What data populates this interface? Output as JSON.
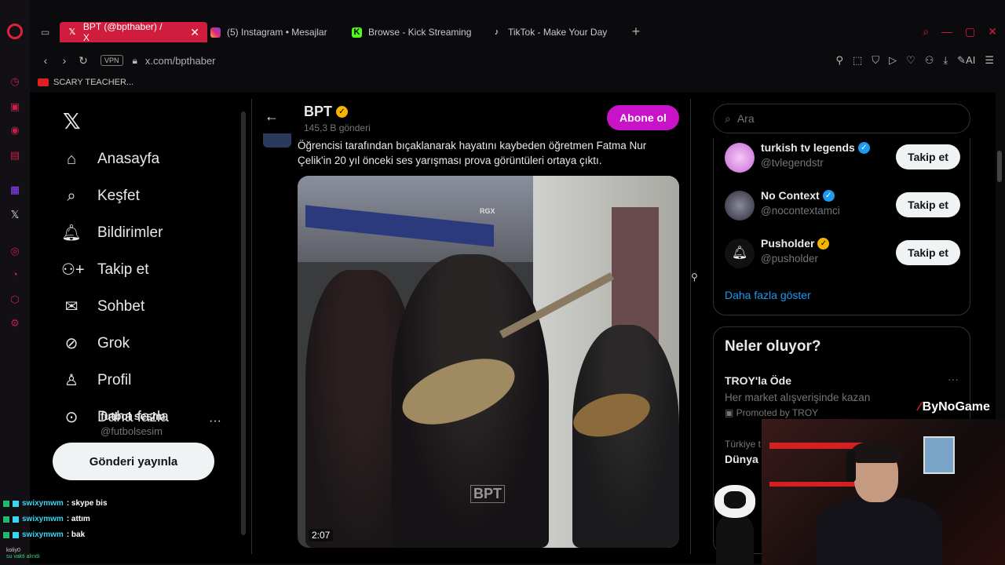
{
  "browser": {
    "tabs": [
      {
        "label": "BPT (@bpthaber) / X",
        "favicon": "X",
        "active": true
      },
      {
        "label": "(5) Instagram • Mesajlar",
        "favicon": "instagram",
        "active": false
      },
      {
        "label": "Browse - Kick Streaming",
        "favicon": "K",
        "active": false
      },
      {
        "label": "TikTok - Make Your Day",
        "favicon": "tiktok",
        "active": false
      }
    ],
    "url": "x.com/bpthaber",
    "vpn_label": "VPN",
    "ai_label": "AI",
    "bookmark": "SCARY TEACHER...",
    "accent_color": "#d11d3d"
  },
  "x_nav": {
    "items": [
      {
        "label": "Anasayfa",
        "icon": "home-icon"
      },
      {
        "label": "Keşfet",
        "icon": "search-icon"
      },
      {
        "label": "Bildirimler",
        "icon": "bell-icon"
      },
      {
        "label": "Takip et",
        "icon": "add-user-icon"
      },
      {
        "label": "Sohbet",
        "icon": "mail-icon"
      },
      {
        "label": "Grok",
        "icon": "grok-icon"
      },
      {
        "label": "Profil",
        "icon": "person-icon"
      },
      {
        "label": "Daha fazla",
        "icon": "more-circle-icon"
      }
    ],
    "post_button": "Gönderi yayınla",
    "account": {
      "name": "futbol sesim",
      "handle": "@futbolsesim"
    }
  },
  "profile": {
    "name": "BPT",
    "post_count": "145,3 B gönderi",
    "subscribe_button": "Abone ol"
  },
  "tweet": {
    "text": "Öğrencisi tarafından bıçaklanarak hayatını kaybeden öğretmen Fatma Nur Çelik'in 20 yıl önceki ses yarışması prova görüntüleri ortaya çıktı.",
    "video_time": "2:07",
    "watermark_top": "RGX",
    "watermark_bottom": "BPT"
  },
  "right": {
    "search_placeholder": "Ara",
    "who_to_follow": [
      {
        "name": "turkish tv legends",
        "handle": "@tvlegendstr",
        "button": "Takip et",
        "avatar_color": "#e8a0e8"
      },
      {
        "name": "No Context",
        "handle": "@nocontextamci",
        "button": "Takip et",
        "avatar_color": "#4a4a5a"
      },
      {
        "name": "Pusholder",
        "handle": "@pusholder",
        "button": "Takip et",
        "avatar_color": "#111111"
      }
    ],
    "show_more": "Daha fazla göster",
    "trends_title": "Neler oluyor?",
    "trend_promo": {
      "name": "TROY'la Öde",
      "desc": "Her market alışverişinde kazan",
      "promoted": "Promoted by TROY"
    },
    "trend_2": {
      "category": "Türkiye t",
      "name": "Dünya"
    }
  },
  "stream": {
    "brand": "ByNoGame",
    "chat": [
      {
        "user": "swixymwm",
        "msg": ": skype bis"
      },
      {
        "user": "swixymwm",
        "msg": ": attım"
      },
      {
        "user": "swixymwm",
        "msg": ": bak"
      }
    ],
    "footer_user": "koliy0",
    "footer_sub": "su vakti alındı"
  }
}
